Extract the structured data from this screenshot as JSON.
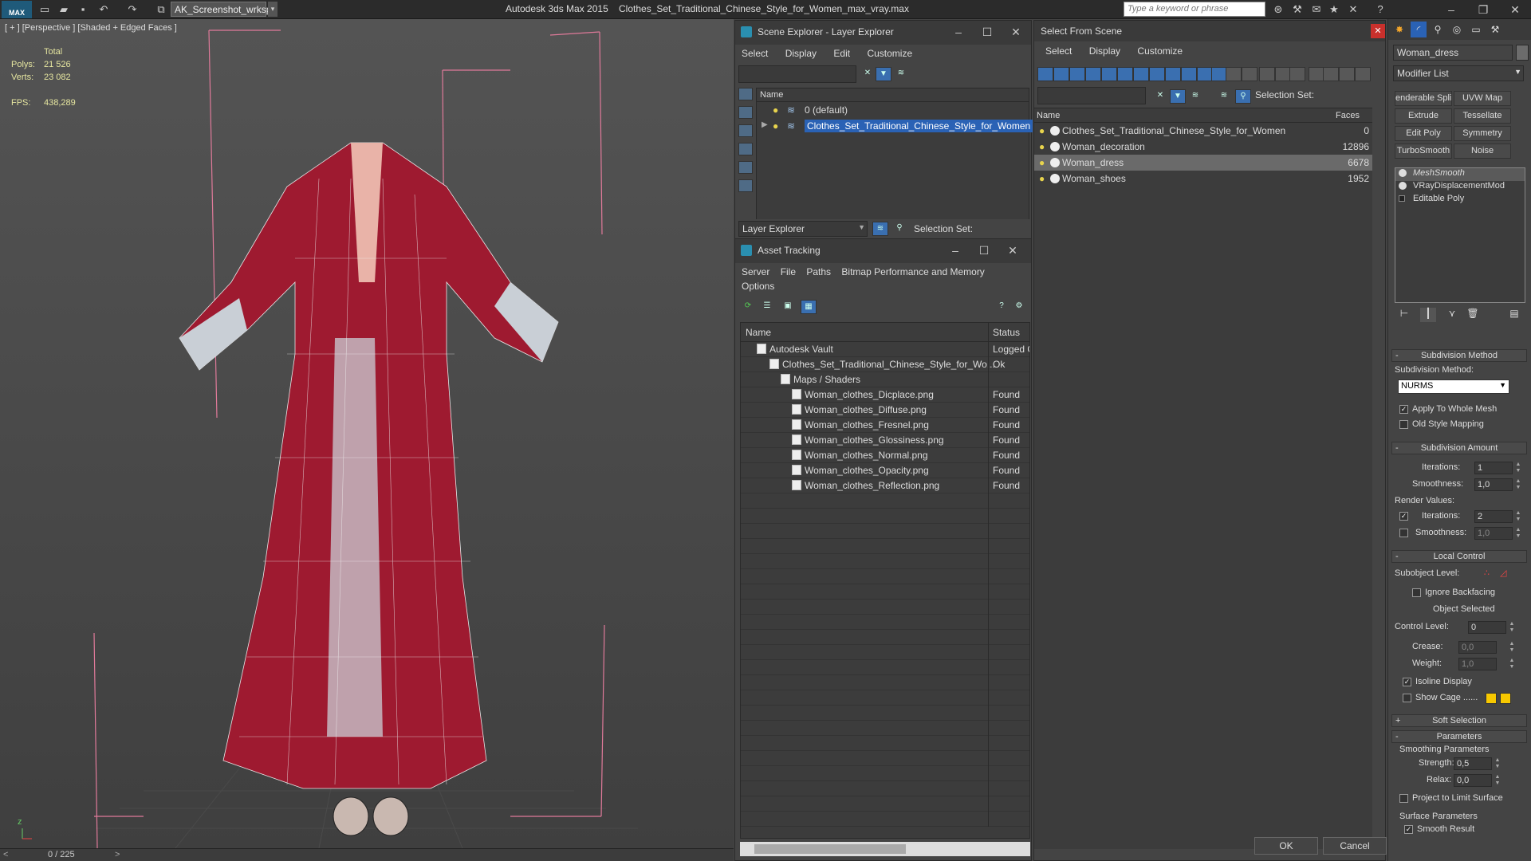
{
  "titlebar": {
    "logo": "MAX",
    "workspace": "AK_Screenshot_wrksp",
    "app_title": "Autodesk 3ds Max  2015",
    "file_title": "Clothes_Set_Traditional_Chinese_Style_for_Women_max_vray.max",
    "search_placeholder": "Type a keyword or phrase"
  },
  "viewport": {
    "label": "[ + ] [Perspective ] [Shaded + Edged Faces ]",
    "stats": {
      "total_label": "Total",
      "polys_label": "Polys:",
      "polys": "21 526",
      "verts_label": "Verts:",
      "verts": "23 082",
      "fps_label": "FPS:",
      "fps": "438,289"
    },
    "frame_counter": "0 / 225",
    "prev": "<",
    "next": ">"
  },
  "scene_explorer": {
    "title": "Scene Explorer - Layer Explorer",
    "menu": [
      "Select",
      "Display",
      "Edit",
      "Customize"
    ],
    "column_name": "Name",
    "rows": [
      "0 (default)",
      "Clothes_Set_Traditional_Chinese_Style_for_Women"
    ],
    "layer_dropdown": "Layer Explorer",
    "selection_set_label": "Selection Set:"
  },
  "asset_tracking": {
    "title": "Asset Tracking",
    "menu_row1": [
      "Server",
      "File",
      "Paths",
      "Bitmap Performance and Memory"
    ],
    "menu_row2": [
      "Options"
    ],
    "col_name": "Name",
    "col_status": "Status",
    "rows": [
      {
        "name": "Autodesk Vault",
        "status": "Logged Out",
        "indent": 1
      },
      {
        "name": "Clothes_Set_Traditional_Chinese_Style_for_Wo...",
        "status": "Ok",
        "indent": 2
      },
      {
        "name": "Maps / Shaders",
        "status": "",
        "indent": 3
      },
      {
        "name": "Woman_clothes_Dicplace.png",
        "status": "Found",
        "indent": 4
      },
      {
        "name": "Woman_clothes_Diffuse.png",
        "status": "Found",
        "indent": 4
      },
      {
        "name": "Woman_clothes_Fresnel.png",
        "status": "Found",
        "indent": 4
      },
      {
        "name": "Woman_clothes_Glossiness.png",
        "status": "Found",
        "indent": 4
      },
      {
        "name": "Woman_clothes_Normal.png",
        "status": "Found",
        "indent": 4
      },
      {
        "name": "Woman_clothes_Opacity.png",
        "status": "Found",
        "indent": 4
      },
      {
        "name": "Woman_clothes_Reflection.png",
        "status": "Found",
        "indent": 4
      }
    ]
  },
  "select_from_scene": {
    "title": "Select From Scene",
    "menu": [
      "Select",
      "Display",
      "Customize"
    ],
    "selection_set_label": "Selection Set:",
    "col_name": "Name",
    "col_faces": "Faces",
    "rows": [
      {
        "name": "Clothes_Set_Traditional_Chinese_Style_for_Women",
        "faces": "0",
        "selected": false
      },
      {
        "name": "Woman_decoration",
        "faces": "12896",
        "selected": false
      },
      {
        "name": "Woman_dress",
        "faces": "6678",
        "selected": true
      },
      {
        "name": "Woman_shoes",
        "faces": "1952",
        "selected": false
      }
    ],
    "ok": "OK",
    "cancel": "Cancel"
  },
  "command_panel": {
    "object_name": "Woman_dress",
    "modifier_list": "Modifier List",
    "mod_buttons": [
      "enderable Splir",
      "UVW Map",
      "Extrude",
      "Tessellate",
      "Edit Poly",
      "Symmetry",
      "TurboSmooth",
      "Noise"
    ],
    "stack": [
      "MeshSmooth",
      "VRayDisplacementMod",
      "Editable Poly"
    ],
    "subdivision_method_title": "Subdivision Method",
    "subdivision_method_label": "Subdivision Method:",
    "subdivision_method_value": "NURMS",
    "apply_whole_mesh": "Apply To Whole Mesh",
    "old_style_mapping": "Old Style Mapping",
    "subdivision_amount_title": "Subdivision Amount",
    "iterations_label": "Iterations:",
    "iterations": "1",
    "smoothness_label": "Smoothness:",
    "smoothness": "1,0",
    "render_values_label": "Render Values:",
    "render_iterations": "2",
    "render_smoothness": "1,0",
    "local_control_title": "Local Control",
    "subobject_level_label": "Subobject Level:",
    "ignore_backfacing": "Ignore Backfacing",
    "object_selected": "Object Selected",
    "control_level_label": "Control Level:",
    "control_level": "0",
    "crease_label": "Crease:",
    "crease": "0,0",
    "weight_label": "Weight:",
    "weight": "1,0",
    "isoline_display": "Isoline Display",
    "show_cage": "Show Cage ......",
    "soft_selection_title": "Soft Selection",
    "parameters_title": "Parameters",
    "smoothing_params_label": "Smoothing Parameters",
    "strength_label": "Strength:",
    "strength": "0,5",
    "relax_label": "Relax:",
    "relax": "0,0",
    "project_limit": "Project to Limit Surface",
    "surface_params_label": "Surface Parameters",
    "smooth_result": "Smooth Result"
  }
}
